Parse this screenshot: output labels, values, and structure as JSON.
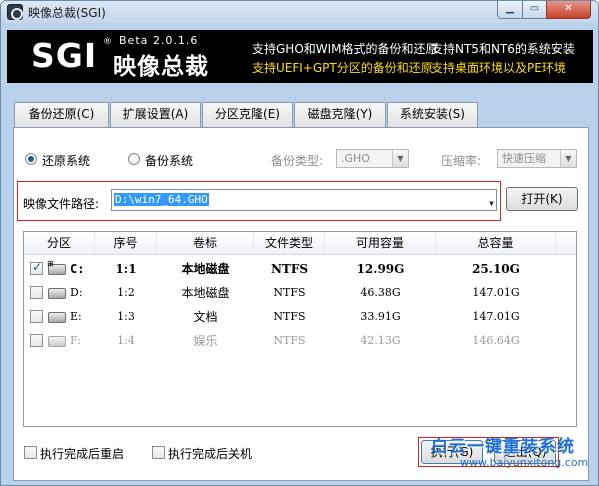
{
  "window": {
    "title": "映像总裁(SGI)",
    "icons": [
      "app-icon",
      "minimize-icon",
      "maximize-icon",
      "close-icon"
    ],
    "close_glyph": "✕"
  },
  "banner": {
    "logo": "SGI",
    "logo_mark": "®",
    "version": "Beta 2.0.1.6",
    "product": "映像总裁",
    "features": [
      {
        "text": "支持GHO和WIM格式的备份和还原",
        "color": "#ffffff"
      },
      {
        "text": "支持NT5和NT6的系统安装",
        "color": "#ffffff"
      },
      {
        "text": "支持UEFI+GPT分区的备份和还原",
        "color": "#ffde00"
      },
      {
        "text": "支持桌面环境以及PE环境",
        "color": "#ffde00"
      }
    ]
  },
  "tabs": [
    {
      "label": "备份还原(C)",
      "active": true
    },
    {
      "label": "扩展设置(A)",
      "active": false
    },
    {
      "label": "分区克隆(E)",
      "active": false
    },
    {
      "label": "磁盘克隆(Y)",
      "active": false
    },
    {
      "label": "系统安装(S)",
      "active": false
    }
  ],
  "mode": {
    "restore_label": "还原系统",
    "backup_label": "备份系统",
    "selected": "restore",
    "backup_type_label": "备份类型:",
    "backup_type_value": ".GHO",
    "compression_label": "压缩率:",
    "compression_value": "快速压缩"
  },
  "image_path": {
    "label": "映像文件路径:",
    "value": "D:\\win7_64.GHO",
    "open_button": "打开(K)"
  },
  "table": {
    "columns": [
      "分区",
      "序号",
      "卷标",
      "文件类型",
      "可用容量",
      "总容量"
    ],
    "rows": [
      {
        "checked": true,
        "drive": "C:",
        "index": "1:1",
        "label": "本地磁盘",
        "fs": "NTFS",
        "free": "12.99G",
        "total": "25.10G",
        "system": true
      },
      {
        "checked": false,
        "drive": "D:",
        "index": "1:2",
        "label": "本地磁盘",
        "fs": "NTFS",
        "free": "46.38G",
        "total": "147.01G",
        "system": false
      },
      {
        "checked": false,
        "drive": "E:",
        "index": "1:3",
        "label": "文档",
        "fs": "NTFS",
        "free": "33.91G",
        "total": "147.01G",
        "system": false
      },
      {
        "checked": false,
        "drive": "F:",
        "index": "1:4",
        "label": "娱乐",
        "fs": "NTFS",
        "free": "42.13G",
        "total": "146.64G",
        "system": false
      }
    ]
  },
  "options": {
    "reboot_label": "执行完成后重启",
    "shutdown_label": "执行完成后关机"
  },
  "actions": {
    "execute": "执行(G)",
    "exit": "退出(Q)"
  },
  "watermark": {
    "text": "白云一键重装系统",
    "url": "www.baiyunxitong.com"
  },
  "colors": {
    "accent": "#1f5d9b",
    "highlight_border": "#e02020",
    "banner_yellow": "#ffde00"
  }
}
